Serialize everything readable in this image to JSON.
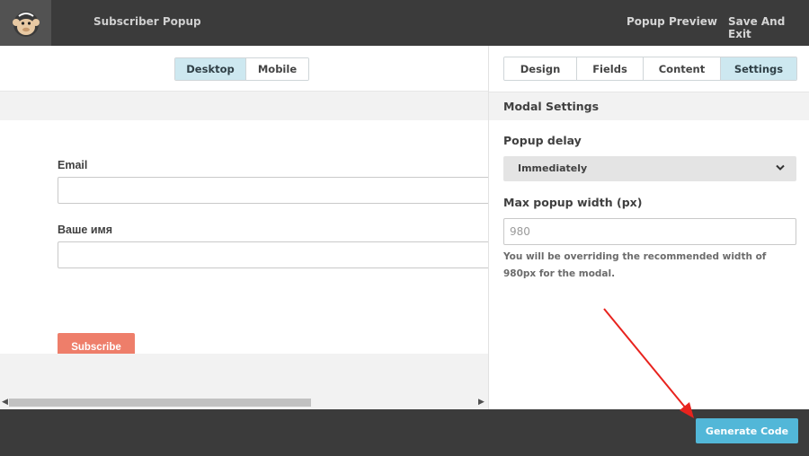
{
  "header": {
    "app_title": "Subscriber Popup",
    "popup_preview_label": "Popup Preview",
    "save_exit_label": "Save And Exit"
  },
  "preview": {
    "device_toggle": [
      {
        "label": "Desktop",
        "active": true
      },
      {
        "label": "Mobile",
        "active": false
      }
    ],
    "form": {
      "email_label": "Email",
      "name_label": "Ваше имя",
      "subscribe_label": "Subscribe"
    }
  },
  "settings": {
    "tabs": [
      {
        "label": "Design",
        "active": false
      },
      {
        "label": "Fields",
        "active": false
      },
      {
        "label": "Content",
        "active": false
      },
      {
        "label": "Settings",
        "active": true
      }
    ],
    "section_title": "Modal Settings",
    "popup_delay": {
      "label": "Popup delay",
      "selected": "Immediately"
    },
    "max_width": {
      "label": "Max popup width (px)",
      "placeholder": "980",
      "help": "You will be overriding the recommended width of 980px for the modal."
    }
  },
  "footer": {
    "generate_code_label": "Generate Code"
  },
  "colors": {
    "topbar": "#3b3b3b",
    "active_tab": "#cde8f0",
    "subscribe_button": "#ee7e6a",
    "generate_button": "#52b7d8",
    "annotation_arrow": "#e8231e"
  },
  "icons": {
    "logo": "chimp-logo-icon",
    "select_indicator": "chevron-down-icon",
    "scroll_left": "scroll-left-arrow-icon",
    "scroll_right": "scroll-right-arrow-icon"
  }
}
